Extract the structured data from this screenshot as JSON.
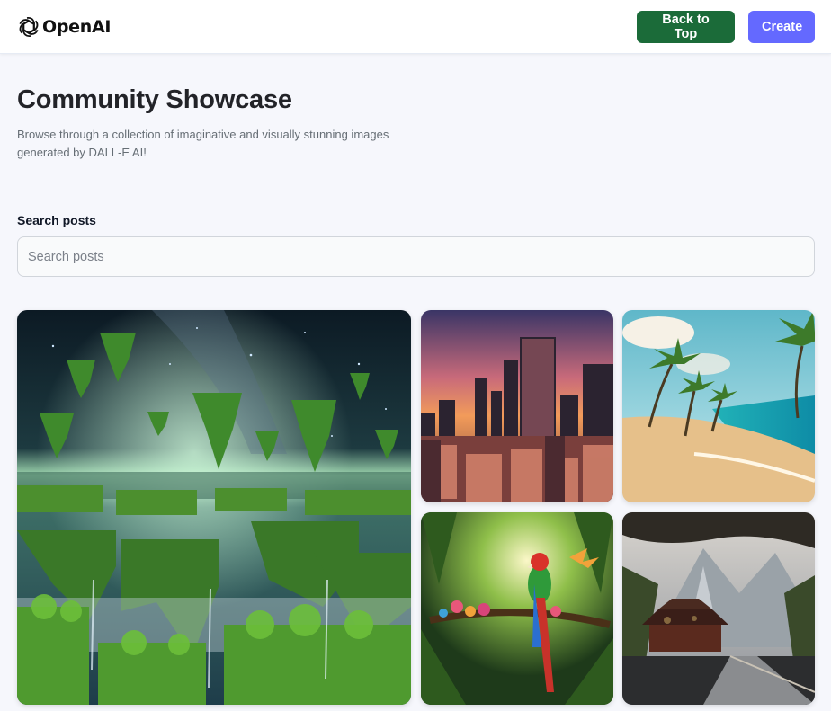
{
  "header": {
    "logo_text": "OpenAI",
    "back_to_top_label": "Back to Top",
    "create_label": "Create"
  },
  "main": {
    "title": "Community Showcase",
    "subtitle": "Browse through a collection of imaginative and visually stunning images generated by DALL-E AI!",
    "search": {
      "label": "Search posts",
      "placeholder": "Search posts",
      "value": ""
    }
  },
  "posts": [
    {
      "image": "floating-islands-image"
    },
    {
      "image": "sunset-city-image"
    },
    {
      "image": "tropical-beach-image"
    },
    {
      "image": "parrot-jungle-image"
    },
    {
      "image": "pagoda-lake-image"
    }
  ],
  "colors": {
    "back_to_top": "#1b6b39",
    "create": "#6469ff",
    "background": "#f6f7fc"
  }
}
